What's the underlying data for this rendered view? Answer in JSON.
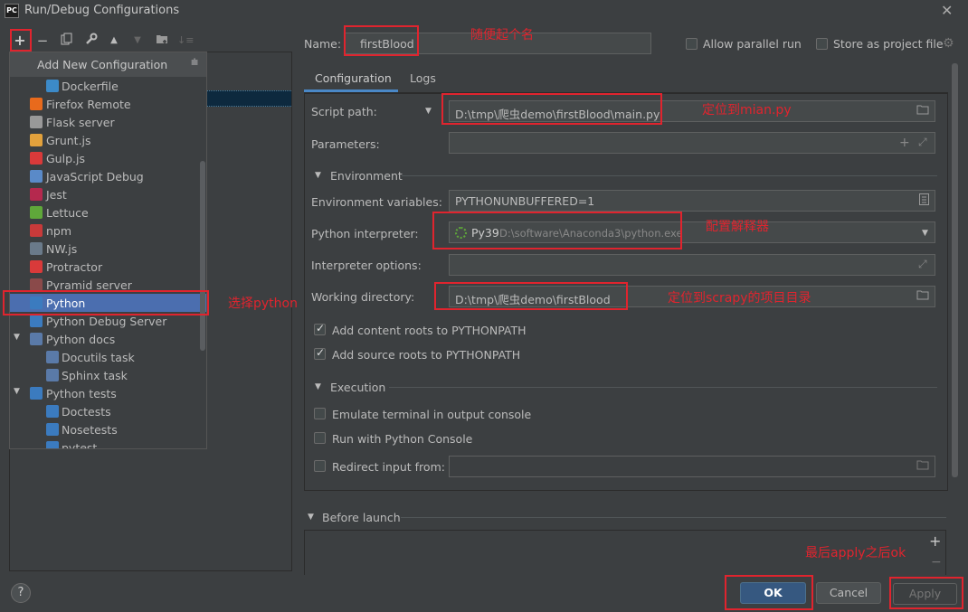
{
  "window": {
    "title": "Run/Debug Configurations",
    "app_icon": "PC"
  },
  "toolbar": {
    "add": "+",
    "remove": "−"
  },
  "popup": {
    "header": "Add New Configuration",
    "items": [
      {
        "label": "Dockerfile",
        "icon": "docker-icon",
        "color": "#3c8ac8"
      },
      {
        "label": "Firefox Remote",
        "icon": "firefox-icon",
        "color": "#e86a1c"
      },
      {
        "label": "Flask server",
        "icon": "flask-icon",
        "color": "#999999"
      },
      {
        "label": "Grunt.js",
        "icon": "grunt-icon",
        "color": "#e2a13c"
      },
      {
        "label": "Gulp.js",
        "icon": "gulp-icon",
        "color": "#d93a3a"
      },
      {
        "label": "JavaScript Debug",
        "icon": "js-debug-icon",
        "color": "#5a8ac8"
      },
      {
        "label": "Jest",
        "icon": "jest-icon",
        "color": "#b5294e"
      },
      {
        "label": "Lettuce",
        "icon": "lettuce-icon",
        "color": "#5fa83a"
      },
      {
        "label": "npm",
        "icon": "npm-icon",
        "color": "#c83a3a"
      },
      {
        "label": "NW.js",
        "icon": "nwjs-icon",
        "color": "#6a7a8a"
      },
      {
        "label": "Protractor",
        "icon": "protractor-icon",
        "color": "#d93a3a"
      },
      {
        "label": "Pyramid server",
        "icon": "pyramid-icon",
        "color": "#8a4a4a"
      },
      {
        "label": "Python",
        "icon": "python-icon",
        "color": "#3b7bbf"
      },
      {
        "label": "Python Debug Server",
        "icon": "python-debug-icon",
        "color": "#3b7bbf"
      },
      {
        "label": "Python docs",
        "icon": "docs-icon",
        "color": "#5a7aa8"
      },
      {
        "label": "Docutils task",
        "icon": "docs-icon",
        "color": "#5a7aa8"
      },
      {
        "label": "Sphinx task",
        "icon": "docs-icon",
        "color": "#5a7aa8"
      },
      {
        "label": "Python tests",
        "icon": "python-tests-icon",
        "color": "#3b7bbf"
      },
      {
        "label": "Doctests",
        "icon": "python-tests-icon",
        "color": "#3b7bbf"
      },
      {
        "label": "Nosetests",
        "icon": "python-tests-icon",
        "color": "#3b7bbf"
      },
      {
        "label": "pytest",
        "icon": "python-tests-icon",
        "color": "#3b7bbf"
      }
    ]
  },
  "form": {
    "name_label": "Name:",
    "name_value": "firstBlood",
    "allow_parallel": "Allow parallel run",
    "store_project": "Store as project file",
    "tab_configuration": "Configuration",
    "tab_logs": "Logs",
    "script_path_label": "Script path:",
    "script_path_value": "D:\\tmp\\爬虫demo\\firstBlood\\main.py",
    "parameters_label": "Parameters:",
    "environment_section": "Environment",
    "env_vars_label": "Environment variables:",
    "env_vars_value": "PYTHONUNBUFFERED=1",
    "interpreter_label": "Python interpreter:",
    "interpreter_name": "Py39",
    "interpreter_path": "D:\\software\\Anaconda3\\python.exe",
    "interp_options_label": "Interpreter options:",
    "working_dir_label": "Working directory:",
    "working_dir_value": "D:\\tmp\\爬虫demo\\firstBlood",
    "add_content_roots": "Add content roots to PYTHONPATH",
    "add_source_roots": "Add source roots to PYTHONPATH",
    "execution_section": "Execution",
    "emulate_terminal": "Emulate terminal in output console",
    "run_with_console": "Run with Python Console",
    "redirect_input": "Redirect input from:",
    "before_launch": "Before launch"
  },
  "annotations": {
    "name_note": "随便起个名",
    "script_note": "定位到mian.py",
    "python_note": "选择python",
    "interpreter_note": "配置解释器",
    "workdir_note": "定位到scrapy的项目目录",
    "apply_note": "最后apply之后ok"
  },
  "buttons": {
    "ok": "OK",
    "cancel": "Cancel",
    "apply": "Apply",
    "help": "?"
  }
}
